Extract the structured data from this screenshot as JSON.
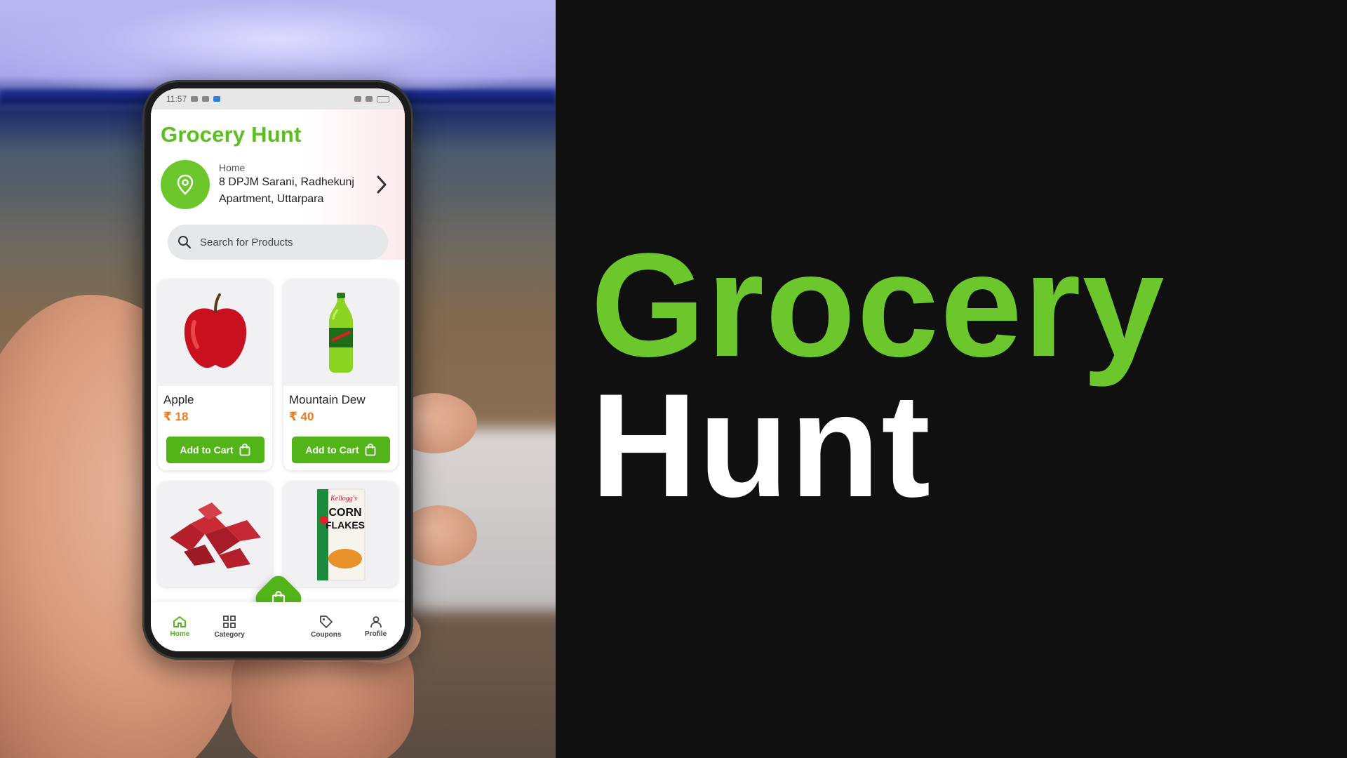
{
  "hero": {
    "line1": "Grocery",
    "line2": "Hunt"
  },
  "status_bar": {
    "time": "11:57"
  },
  "app": {
    "title": "Grocery Hunt",
    "address": {
      "label": "Home",
      "line1": "8 DPJM Sarani, Radhekunj",
      "line2": "Apartment, Uttarpara"
    },
    "search": {
      "placeholder": "Search for Products"
    },
    "products": [
      {
        "name": "Apple",
        "price": "₹ 18",
        "button": "Add to Cart",
        "icon": "apple-image"
      },
      {
        "name": "Mountain Dew",
        "price": "₹ 40",
        "button": "Add to Cart",
        "icon": "soda-bottle-image"
      },
      {
        "icon": "meat-image"
      },
      {
        "brand": "Kellogg's",
        "line1": "CORN",
        "line2": "FLAKES",
        "icon": "cereal-box-image"
      }
    ],
    "nav": [
      {
        "label": "Home",
        "icon": "home-icon",
        "active": true
      },
      {
        "label": "Category",
        "icon": "grid-icon"
      },
      {
        "label": "Coupons",
        "icon": "tag-icon"
      },
      {
        "label": "Profile",
        "icon": "user-icon"
      }
    ]
  },
  "colors": {
    "brand_green": "#5cbf21",
    "price_orange": "#f07a1d",
    "dark_bg": "#101010"
  }
}
